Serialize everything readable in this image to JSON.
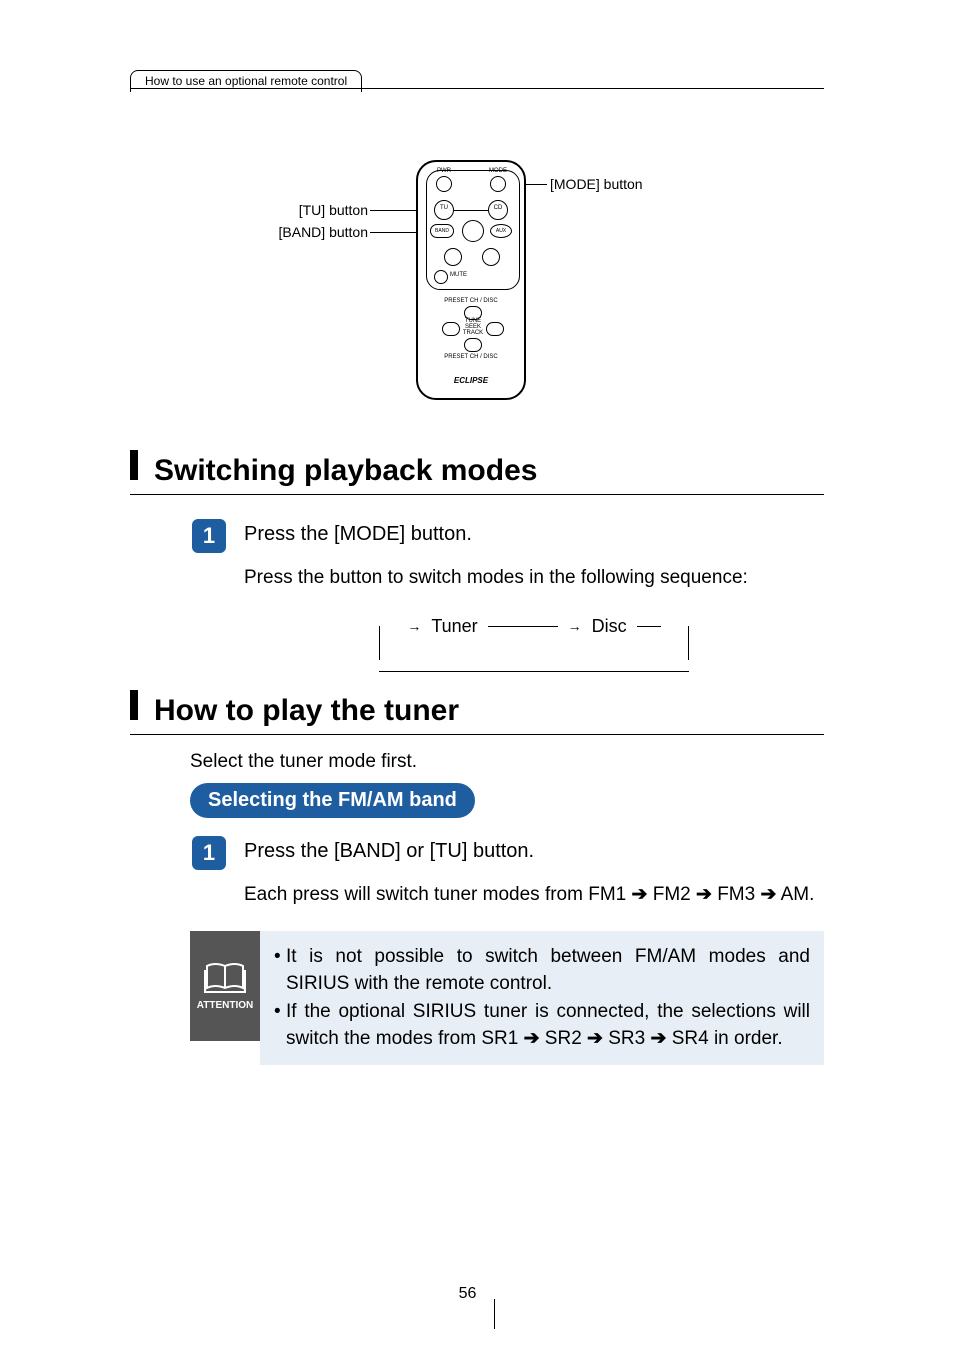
{
  "header": {
    "tab": "How to use an optional remote control"
  },
  "figure": {
    "labels": {
      "mode": "[MODE] button",
      "tu": "[TU] button",
      "band": "[BAND] button"
    },
    "remote_text": {
      "pwr": "PWR",
      "mode": "MODE",
      "tu": "TU",
      "cd": "CD",
      "band": "BAND",
      "aux": "AUX",
      "mute": "MUTE",
      "preset_up": "PRESET CH / DISC",
      "preset_down": "PRESET CH / DISC",
      "tune_seek_track": "TUNE\nSEEK\nTRACK",
      "brand": "ECLIPSE"
    }
  },
  "section1": {
    "title": "Switching playback modes",
    "step1_title": "Press the [MODE] button.",
    "step1_text": "Press the button to switch modes in the following sequence:",
    "loop": {
      "a": "Tuner",
      "b": "Disc"
    }
  },
  "section2": {
    "title": "How to play the tuner",
    "intro": "Select the tuner mode first.",
    "sub": "Selecting the FM/AM band",
    "step1_title": "Press the [BAND] or [TU] button.",
    "step1_text_a": "Each press will switch tuner modes from FM1 ",
    "step1_text_b": " FM2 ",
    "step1_text_c": " FM3 ",
    "step1_text_d": " AM.",
    "attention_label": "ATTENTION",
    "attention": {
      "b1": "It is not possible to switch between FM/AM modes and SIRIUS with the remote control.",
      "b2_a": "If the optional SIRIUS tuner is connected, the selections will switch the modes from SR1 ",
      "b2_b": " SR2 ",
      "b2_c": " SR3 ",
      "b2_d": " SR4 in order."
    }
  },
  "page_number": "56",
  "arrow": "➔"
}
